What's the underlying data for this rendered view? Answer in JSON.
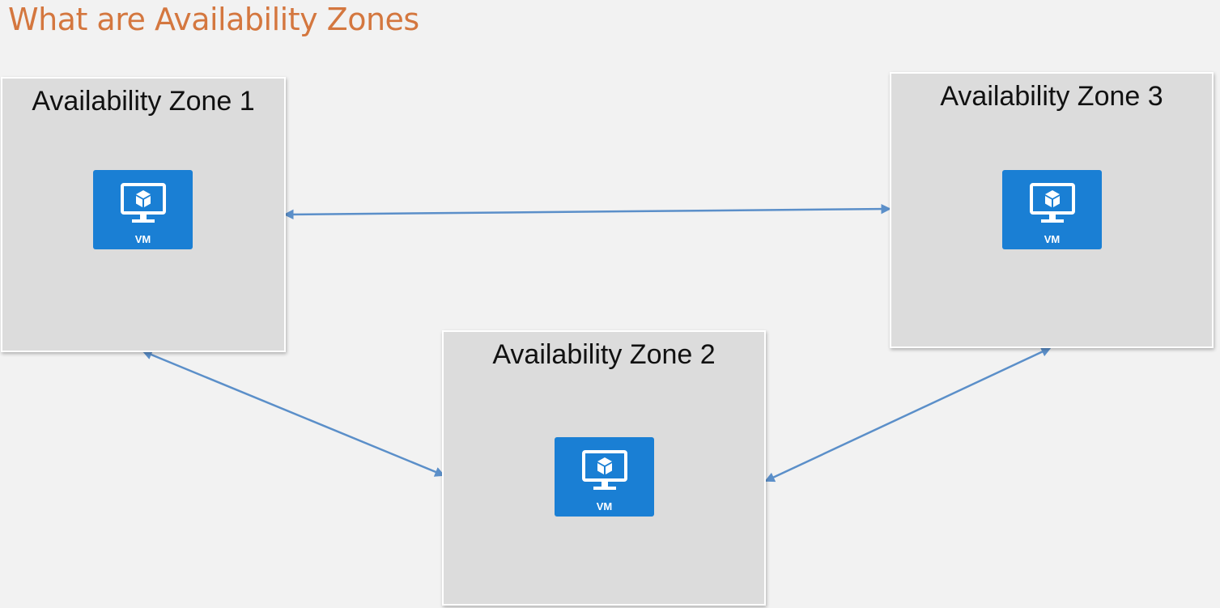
{
  "title": "What are Availability Zones",
  "zones": [
    {
      "label": "Availability Zone 1",
      "vm": {
        "label": "VM",
        "icon": "virtual-machine-icon"
      }
    },
    {
      "label": "Availability Zone 2",
      "vm": {
        "label": "VM",
        "icon": "virtual-machine-icon"
      }
    },
    {
      "label": "Availability Zone 3",
      "vm": {
        "label": "VM",
        "icon": "virtual-machine-icon"
      }
    }
  ],
  "connections": [
    {
      "from": "Availability Zone 1",
      "to": "Availability Zone 3",
      "bidirectional": true
    },
    {
      "from": "Availability Zone 1",
      "to": "Availability Zone 2",
      "bidirectional": true
    },
    {
      "from": "Availability Zone 2",
      "to": "Availability Zone 3",
      "bidirectional": true
    }
  ],
  "colors": {
    "title": "#d4773f",
    "background": "#f2f2f2",
    "zone_fill": "#dcdcdc",
    "vm_tile": "#1a7fd4",
    "connector": "#5b8fc9"
  }
}
